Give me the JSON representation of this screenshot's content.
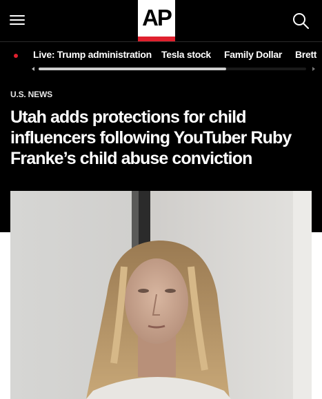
{
  "header": {
    "menu_icon": "hamburger-menu-icon",
    "logo_text": "AP",
    "search_icon": "search-icon"
  },
  "trending": {
    "items": [
      {
        "label": "Live: Trump administration",
        "live": true
      },
      {
        "label": "Tesla stock"
      },
      {
        "label": "Family Dollar"
      },
      {
        "label": "Brett"
      }
    ]
  },
  "article": {
    "section": "U.S. NEWS",
    "headline": "Utah adds protections for child influencers following YouTuber Ruby Franke’s child abuse conviction"
  },
  "colors": {
    "background_dark": "#000000",
    "brand_red": "#e0202e",
    "text_white": "#ffffff"
  }
}
